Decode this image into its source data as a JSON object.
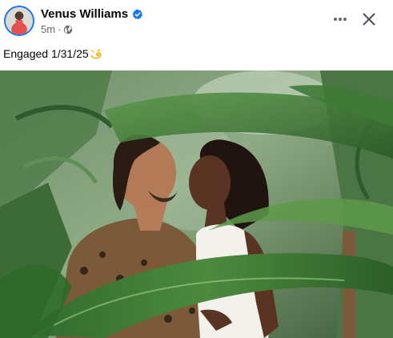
{
  "post": {
    "author": {
      "name": "Venus Williams",
      "verified": true
    },
    "meta": {
      "time": "5m",
      "separator": "·",
      "audience_icon": "globe-icon"
    },
    "actions": {
      "more_icon": "more-horizontal-icon",
      "close_icon": "close-icon"
    },
    "text": "Engaged 1/31/25",
    "emoji_icon": "dizzy-emoji-icon",
    "colors": {
      "verified_badge": "#1877f2",
      "meta_text": "#65676b",
      "primary_text": "#050505"
    }
  }
}
